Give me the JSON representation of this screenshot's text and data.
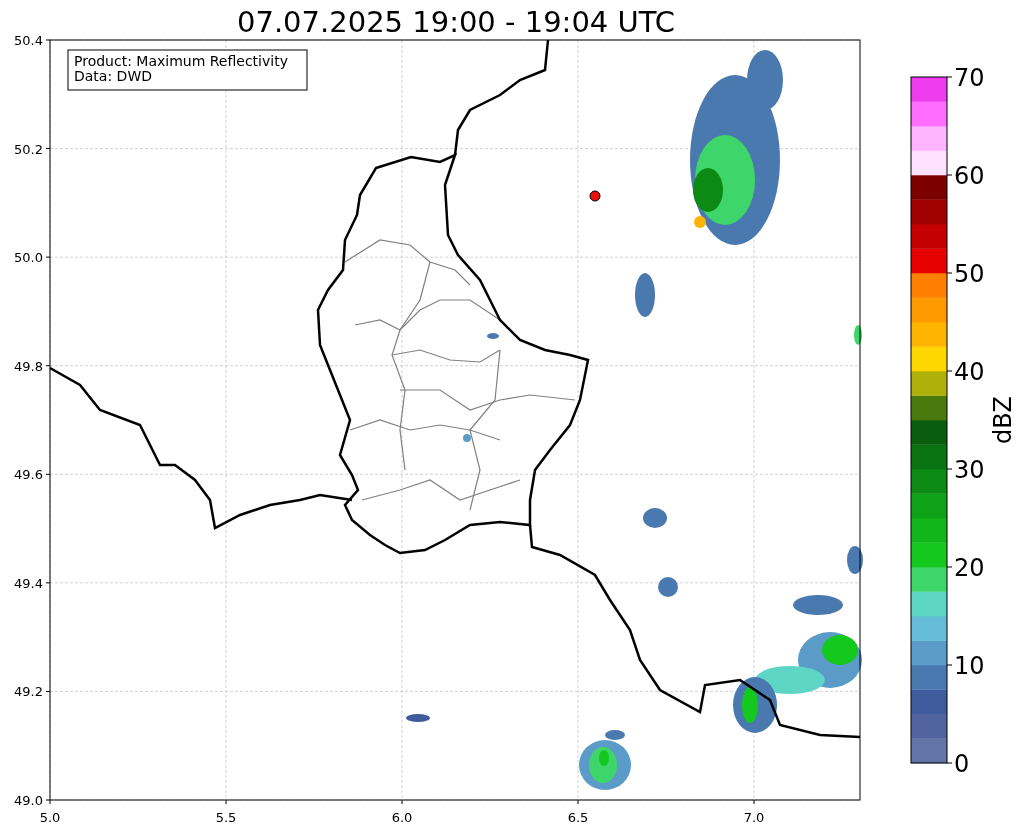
{
  "title": "07.07.2025 19:00 - 19:04 UTC",
  "info_box": {
    "lines": [
      "Product: Maximum Reflectivity",
      "Data: DWD"
    ]
  },
  "map": {
    "x_ticks": [
      "5.0",
      "5.5",
      "6.0",
      "6.5",
      "7.0"
    ],
    "y_ticks": [
      "50.4",
      "50.2",
      "50.0",
      "49.8",
      "49.6",
      "49.4",
      "49.2",
      "49.0"
    ]
  },
  "colorbar": {
    "label": "dBZ",
    "ticks": [
      "70",
      "60",
      "50",
      "40",
      "30",
      "20",
      "10",
      "0"
    ],
    "bands": [
      {
        "color": "#6374a8"
      },
      {
        "color": "#52649f"
      },
      {
        "color": "#405c9e"
      },
      {
        "color": "#4a79b0"
      },
      {
        "color": "#5b9bc7"
      },
      {
        "color": "#64bcd9"
      },
      {
        "color": "#5ed6c6"
      },
      {
        "color": "#3ed66a"
      },
      {
        "color": "#14c81e"
      },
      {
        "color": "#10b61a"
      },
      {
        "color": "#0fa218"
      },
      {
        "color": "#0c8a14"
      },
      {
        "color": "#0b7412"
      },
      {
        "color": "#0a5c0f"
      },
      {
        "color": "#4a7a0e"
      },
      {
        "color": "#b0b00a"
      },
      {
        "color": "#ffd700"
      },
      {
        "color": "#ffb400"
      },
      {
        "color": "#ff9a00"
      },
      {
        "color": "#ff7f00"
      },
      {
        "color": "#e60000"
      },
      {
        "color": "#c40000"
      },
      {
        "color": "#a00000"
      },
      {
        "color": "#7d0000"
      },
      {
        "color": "#ffe0ff"
      },
      {
        "color": "#ffb4ff"
      },
      {
        "color": "#ff6eff"
      },
      {
        "color": "#ee3cee"
      }
    ]
  }
}
